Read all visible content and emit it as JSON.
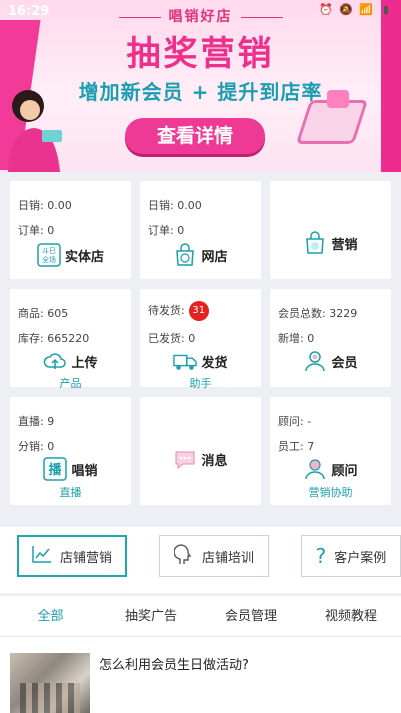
{
  "status_bar": {
    "time": "16:29"
  },
  "banner": {
    "brand": "唱销好店",
    "title": "抽奖营销",
    "subtitle": "增加新会员 + 提升到店率",
    "cta": "查看详情"
  },
  "cards": [
    {
      "line1": "日销:  0.00",
      "line2": "订单:  0",
      "action": "实体店",
      "icon": "store-scan-icon"
    },
    {
      "line1": "日销:  0.00",
      "line2": "订单:  0",
      "action": "网店",
      "icon": "shopping-bag-icon"
    },
    {
      "action": "营销",
      "icon": "marketing-bag-icon"
    },
    {
      "line1": "商品:  605",
      "line2": "库存:  665220",
      "action": "上传",
      "sub": "产品",
      "icon": "upload-cloud-icon"
    },
    {
      "line1": "待发货:",
      "badge": "31",
      "line2": "已发货:  0",
      "action": "发货",
      "sub": "助手",
      "icon": "delivery-truck-icon"
    },
    {
      "line1": "会员总数:  3229",
      "line2": "新增:  0",
      "action": "会员",
      "icon": "member-user-icon"
    },
    {
      "line1": "直播:    9",
      "line2": "分销:  0",
      "action": "唱销",
      "sub": "直播",
      "icon": "live-stream-icon"
    },
    {
      "action": "消息",
      "icon": "message-bubble-icon"
    },
    {
      "line1": "顾问:    -",
      "line2": "员工:  7",
      "action": "顾问",
      "sub": "营销协助",
      "icon": "advisor-user-icon"
    }
  ],
  "shortcuts": [
    {
      "label": "店铺营销",
      "icon": "trend-chart-icon"
    },
    {
      "label": "店铺培训",
      "icon": "head-profile-icon"
    },
    {
      "label": "客户案例",
      "icon": "question-mark-icon"
    }
  ],
  "tabs": [
    "全部",
    "抽奖广告",
    "会员管理",
    "视频教程"
  ],
  "article": {
    "title": "怎么利用会员生日做活动?"
  },
  "colors": {
    "accent": "#1aa0aa",
    "pink": "#ef2f8c",
    "badge": "#e52222"
  }
}
